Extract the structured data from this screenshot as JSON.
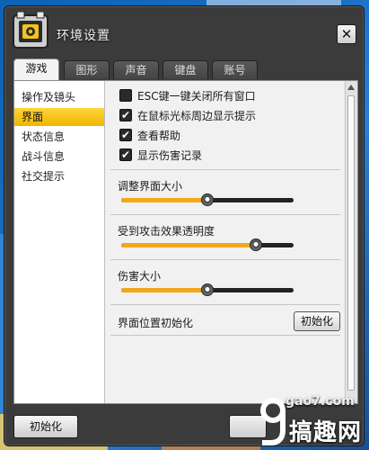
{
  "window": {
    "title": "环境设置"
  },
  "tabs": [
    "游戏",
    "图形",
    "声音",
    "键盘",
    "账号"
  ],
  "active_tab": 0,
  "sidebar": {
    "items": [
      "操作及镜头",
      "界面",
      "状态信息",
      "战斗信息",
      "社交提示"
    ],
    "active": 1
  },
  "options": [
    {
      "label": "ESC键一键关闭所有窗口",
      "checked": false
    },
    {
      "label": "在鼠标光标周边显示提示",
      "checked": true
    },
    {
      "label": "查看帮助",
      "checked": true
    },
    {
      "label": "显示伤害记录",
      "checked": true
    }
  ],
  "sliders": [
    {
      "label": "调整界面大小",
      "value": 0.5
    },
    {
      "label": "受到攻击效果透明度",
      "value": 0.78
    },
    {
      "label": "伤害大小",
      "value": 0.5
    }
  ],
  "ui_position": {
    "label": "界面位置初始化",
    "button": "初始化"
  },
  "footer": {
    "reset_button": "初始化"
  },
  "watermark": {
    "top": "gao7.com",
    "main": "搞趣网"
  },
  "colors": {
    "accent": "#f2a81a",
    "selected": "#ffd53a"
  }
}
